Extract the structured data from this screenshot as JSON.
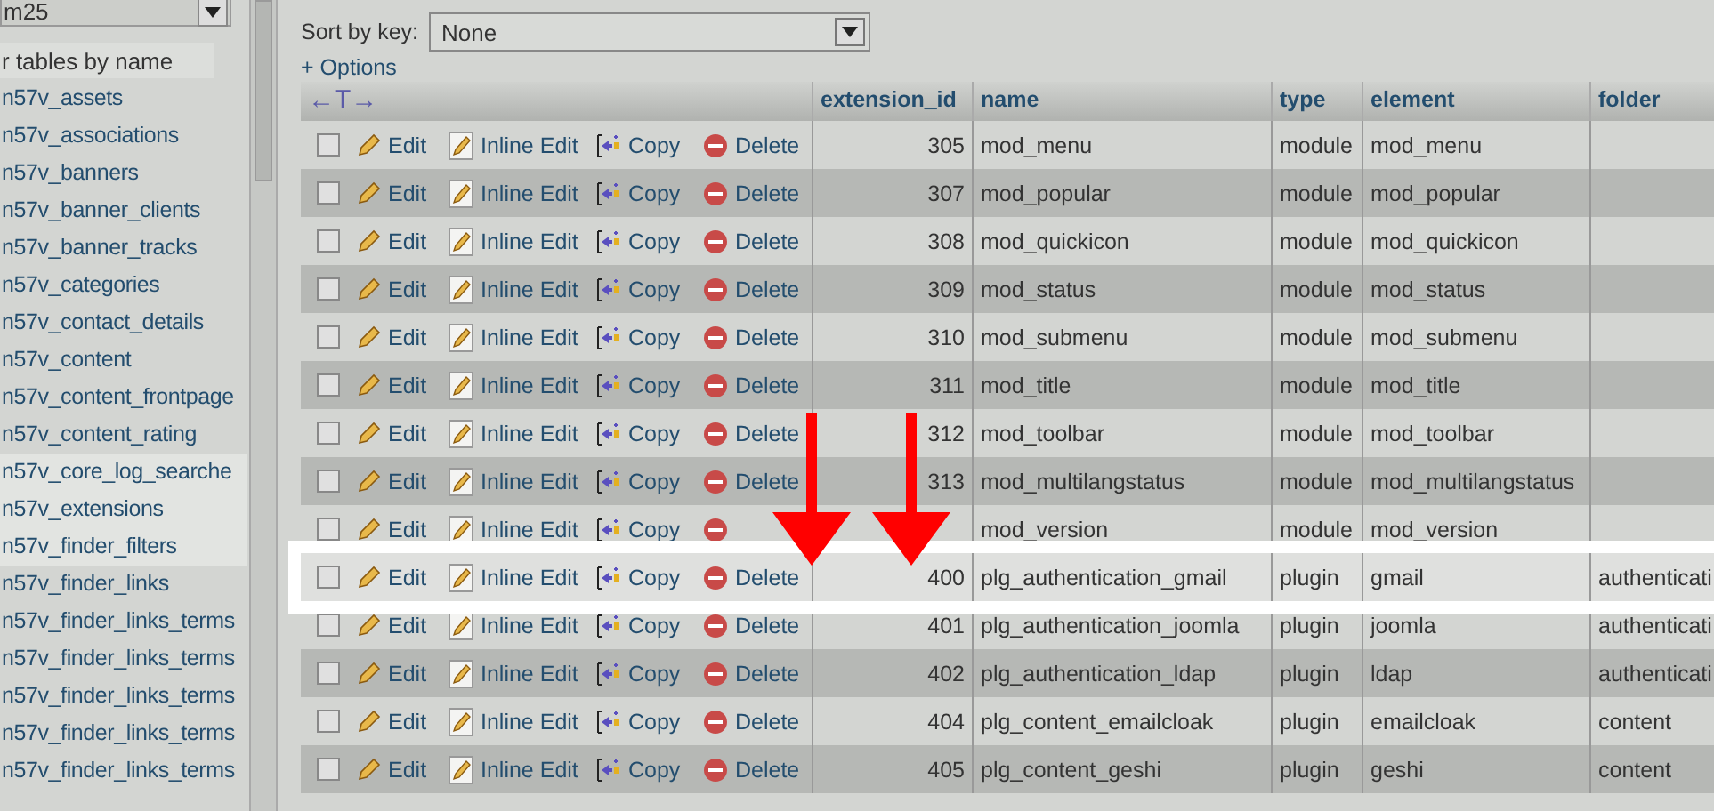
{
  "sidebar": {
    "database": "m25",
    "filter": {
      "placeholder": "r tables by name"
    },
    "tables": [
      {
        "label": "n57v_assets",
        "highlighted": false
      },
      {
        "label": "n57v_associations",
        "highlighted": false
      },
      {
        "label": "n57v_banners",
        "highlighted": false
      },
      {
        "label": "n57v_banner_clients",
        "highlighted": false
      },
      {
        "label": "n57v_banner_tracks",
        "highlighted": false
      },
      {
        "label": "n57v_categories",
        "highlighted": false
      },
      {
        "label": "n57v_contact_details",
        "highlighted": false
      },
      {
        "label": "n57v_content",
        "highlighted": false
      },
      {
        "label": "n57v_content_frontpage",
        "highlighted": false
      },
      {
        "label": "n57v_content_rating",
        "highlighted": false
      },
      {
        "label": "n57v_core_log_searche",
        "highlighted": true
      },
      {
        "label": "n57v_extensions",
        "highlighted": true
      },
      {
        "label": "n57v_finder_filters",
        "highlighted": true
      },
      {
        "label": "n57v_finder_links",
        "highlighted": false
      },
      {
        "label": "n57v_finder_links_terms",
        "highlighted": false
      },
      {
        "label": "n57v_finder_links_terms",
        "highlighted": false
      },
      {
        "label": "n57v_finder_links_terms",
        "highlighted": false
      },
      {
        "label": "n57v_finder_links_terms",
        "highlighted": false
      },
      {
        "label": "n57v_finder_links_terms",
        "highlighted": false
      }
    ]
  },
  "sort": {
    "label": "Sort by key:",
    "value": "None"
  },
  "options_link": "+ Options",
  "table": {
    "resize_handle": "←T→",
    "columns": [
      "extension_id",
      "name",
      "type",
      "element",
      "folder"
    ],
    "rows": [
      {
        "actions": [
          "Edit",
          "Inline Edit",
          "Copy",
          "Delete"
        ],
        "cells": [
          "305",
          "mod_menu",
          "module",
          "mod_menu"
        ],
        "checked": false,
        "highlighted": false
      },
      {
        "actions": [
          "Edit",
          "Inline Edit",
          "Copy",
          "Delete"
        ],
        "cells": [
          "307",
          "mod_popular",
          "module",
          "mod_popular"
        ],
        "checked": false,
        "highlighted": false
      },
      {
        "actions": [
          "Edit",
          "Inline Edit",
          "Copy",
          "Delete"
        ],
        "cells": [
          "308",
          "mod_quickicon",
          "module",
          "mod_quickicon"
        ],
        "checked": false,
        "highlighted": false
      },
      {
        "actions": [
          "Edit",
          "Inline Edit",
          "Copy",
          "Delete"
        ],
        "cells": [
          "309",
          "mod_status",
          "module",
          "mod_status"
        ],
        "checked": false,
        "highlighted": false
      },
      {
        "actions": [
          "Edit",
          "Inline Edit",
          "Copy",
          "Delete"
        ],
        "cells": [
          "310",
          "mod_submenu",
          "module",
          "mod_submenu"
        ],
        "checked": false,
        "highlighted": false
      },
      {
        "actions": [
          "Edit",
          "Inline Edit",
          "Copy",
          "Delete"
        ],
        "cells": [
          "311",
          "mod_title",
          "module",
          "mod_title"
        ],
        "checked": false,
        "highlighted": false
      },
      {
        "actions": [
          "Edit",
          "Inline Edit",
          "Copy",
          "Delete"
        ],
        "cells": [
          "312",
          "mod_toolbar",
          "module",
          "mod_toolbar"
        ],
        "checked": false,
        "highlighted": false
      },
      {
        "actions": [
          "Edit",
          "Inline Edit",
          "Copy",
          "Delete"
        ],
        "cells": [
          "313",
          "mod_multilangstatus",
          "module",
          "mod_multilangstatus"
        ],
        "checked": false,
        "highlighted": false
      },
      {
        "actions": [
          "Edit",
          "Inline Edit",
          "Copy"
        ],
        "cells": [
          null,
          "mod_version",
          "module",
          "mod_version"
        ],
        "checked": false,
        "highlighted": false
      },
      {
        "actions": [
          "Edit",
          "Inline Edit",
          "Copy",
          "Delete"
        ],
        "cells": [
          "400",
          "plg_authentication_gmail",
          "plugin",
          "gmail",
          "authenticati"
        ],
        "checked": false,
        "highlighted": true
      },
      {
        "actions": [
          "Edit",
          "Inline Edit",
          "Copy",
          "Delete"
        ],
        "cells": [
          "401",
          "plg_authentication_joomla",
          "plugin",
          "joomla",
          "authenticati"
        ],
        "checked": false,
        "highlighted": false
      },
      {
        "actions": [
          "Edit",
          "Inline Edit",
          "Copy",
          "Delete"
        ],
        "cells": [
          "402",
          "plg_authentication_ldap",
          "plugin",
          "ldap",
          "authenticati"
        ],
        "checked": false,
        "highlighted": false
      },
      {
        "actions": [
          "Edit",
          "Inline Edit",
          "Copy",
          "Delete"
        ],
        "cells": [
          "404",
          "plg_content_emailcloak",
          "plugin",
          "emailcloak",
          "content"
        ],
        "checked": false,
        "highlighted": false
      },
      {
        "actions": [
          "Edit",
          "Inline Edit",
          "Copy",
          "Delete"
        ],
        "cells": [
          "405",
          "plg_content_geshi",
          "plugin",
          "geshi",
          "content"
        ],
        "checked": false,
        "highlighted": false
      }
    ]
  }
}
